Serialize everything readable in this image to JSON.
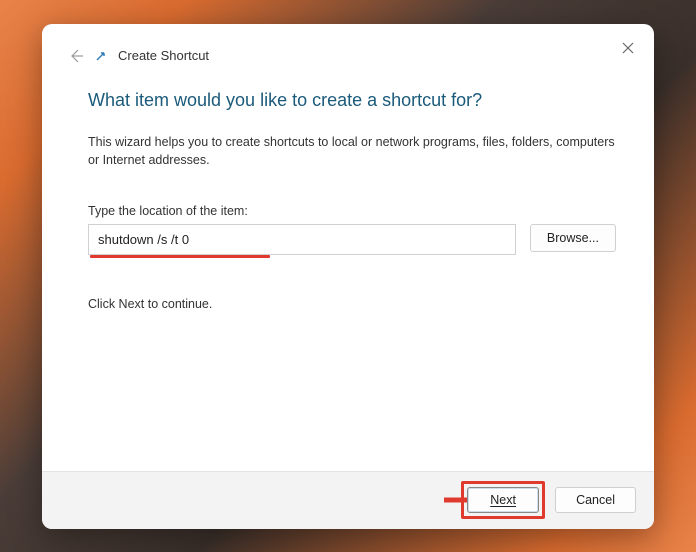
{
  "dialog": {
    "title": "Create Shortcut",
    "heading": "What item would you like to create a shortcut for?",
    "description": "This wizard helps you to create shortcuts to local or network programs, files, folders, computers or Internet addresses.",
    "input_label": "Type the location of the item:",
    "input_value": "shutdown /s /t 0",
    "browse_label": "Browse...",
    "continue_text": "Click Next to continue.",
    "next_label": "Next",
    "cancel_label": "Cancel"
  },
  "annotations": {
    "highlight_color": "#e03a2f"
  }
}
